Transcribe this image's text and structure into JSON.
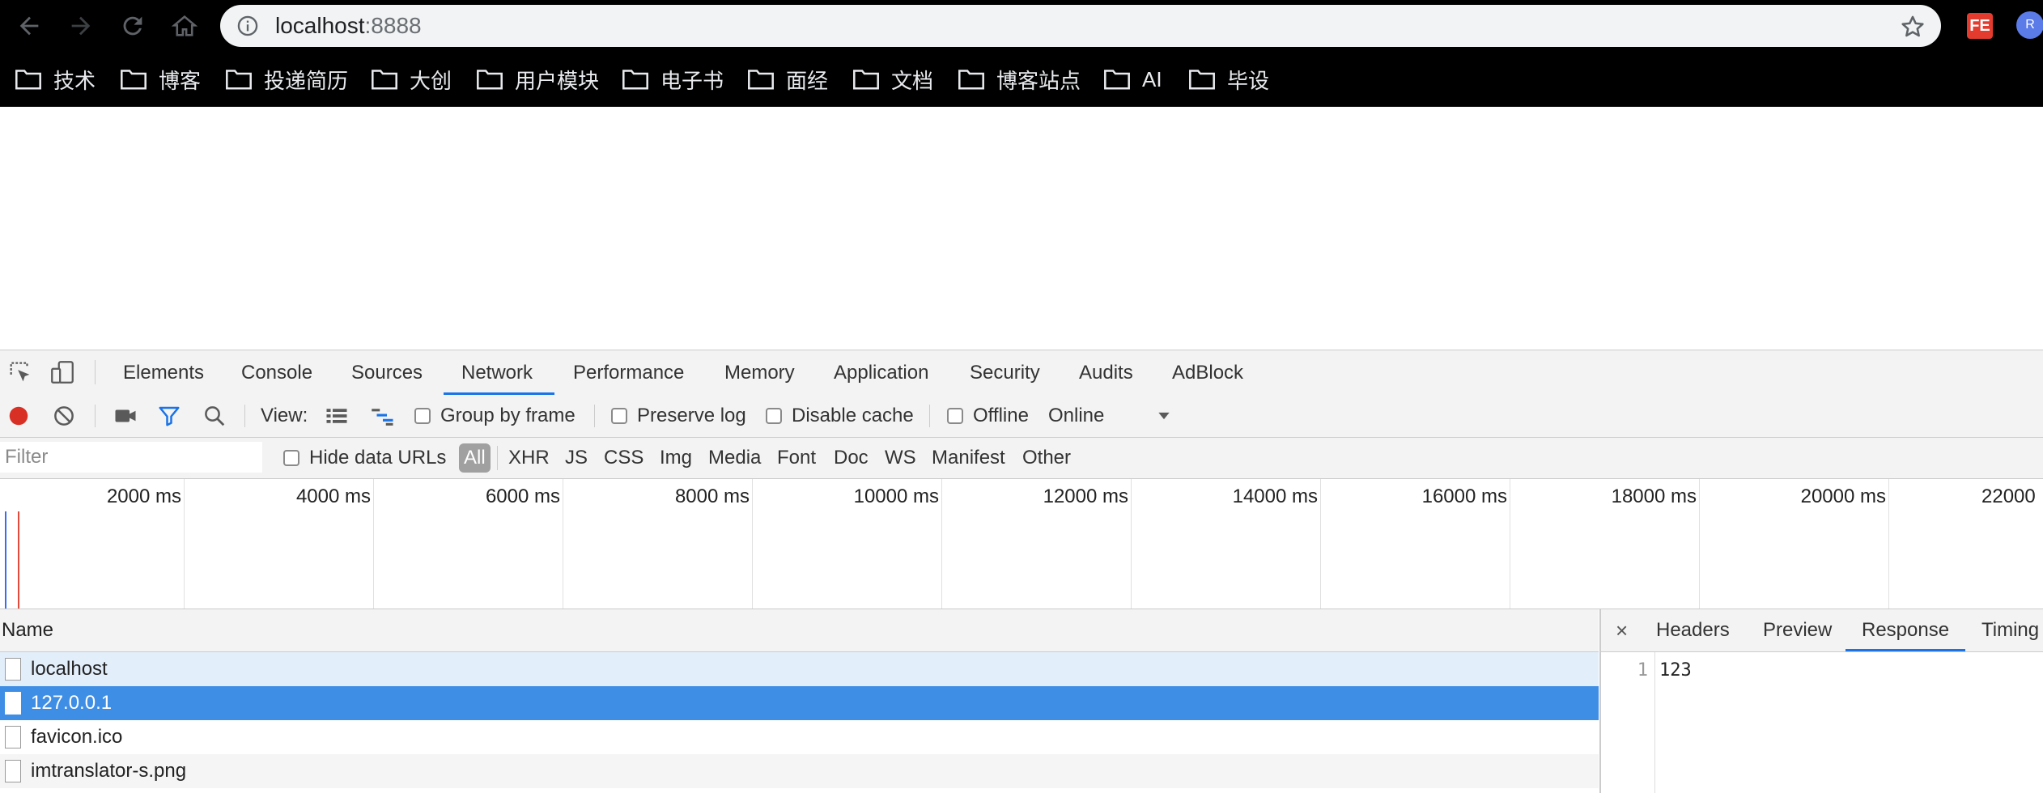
{
  "browser": {
    "url_host": "localhost",
    "url_port": ":8888",
    "extensions": {
      "fe_label": "FE",
      "r_label": "R"
    }
  },
  "bookmarks": [
    "技术",
    "博客",
    "投递简历",
    "大创",
    "用户模块",
    "电子书",
    "面经",
    "文档",
    "博客站点",
    "AI",
    "毕设"
  ],
  "devtools": {
    "tabs": [
      "Elements",
      "Console",
      "Sources",
      "Network",
      "Performance",
      "Memory",
      "Application",
      "Security",
      "Audits",
      "AdBlock"
    ],
    "active_tab": "Network",
    "controls": {
      "view_label": "View:",
      "group_by_frame": "Group by frame",
      "preserve_log": "Preserve log",
      "disable_cache": "Disable cache",
      "offline": "Offline",
      "throttle": "Online"
    },
    "filter": {
      "placeholder": "Filter",
      "hide_data_urls": "Hide data URLs",
      "types": [
        "All",
        "XHR",
        "JS",
        "CSS",
        "Img",
        "Media",
        "Font",
        "Doc",
        "WS",
        "Manifest",
        "Other"
      ]
    },
    "timeline_ticks": [
      "2000 ms",
      "4000 ms",
      "6000 ms",
      "8000 ms",
      "10000 ms",
      "12000 ms",
      "14000 ms",
      "16000 ms",
      "18000 ms",
      "20000 ms",
      "22000"
    ],
    "requests": {
      "header": "Name",
      "items": [
        "localhost",
        "127.0.0.1",
        "favicon.ico",
        "imtranslator-s.png"
      ]
    },
    "detail": {
      "close": "×",
      "tabs": [
        "Headers",
        "Preview",
        "Response",
        "Timing"
      ],
      "active_tab": "Response",
      "line_number": "1",
      "content": "123"
    },
    "colors": {
      "accent": "#1a73e8",
      "record": "#d93025",
      "selected_row": "#3f8ee6"
    }
  }
}
